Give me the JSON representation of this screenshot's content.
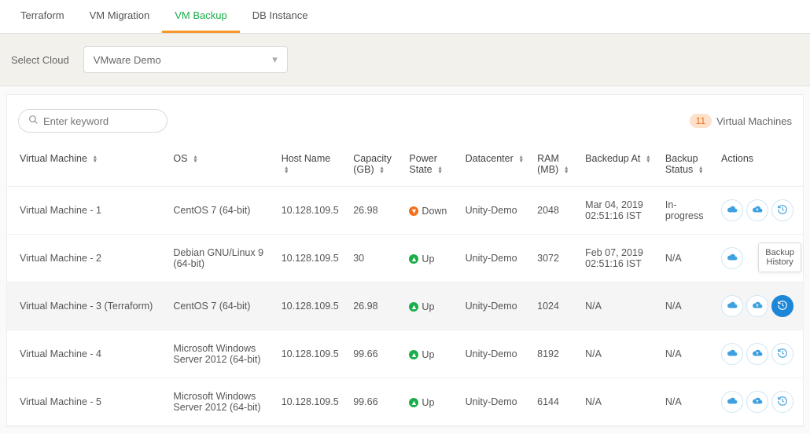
{
  "tabs": [
    "Terraform",
    "VM Migration",
    "VM Backup",
    "DB Instance"
  ],
  "activeTab": 2,
  "filter": {
    "label": "Select Cloud",
    "value": "VMware Demo"
  },
  "search": {
    "placeholder": "Enter keyword"
  },
  "count": {
    "value": "11",
    "label": "Virtual Machines"
  },
  "columns": [
    "Virtual Machine",
    "OS",
    "Host Name",
    "Capacity (GB)",
    "Power State",
    "Datacenter",
    "RAM (MB)",
    "Backedup At",
    "Backup Status",
    "Actions"
  ],
  "tooltip": "Backup History",
  "rows": [
    {
      "vm": "Virtual Machine - 1",
      "os": "CentOS 7 (64-bit)",
      "host": "10.128.109.5",
      "cap": "26.98",
      "power": "Down",
      "dc": "Unity-Demo",
      "ram": "2048",
      "backedup": "Mar 04, 2019 02:51:16 IST",
      "status": "In-progress",
      "hl": false,
      "tooltip": false,
      "press": false
    },
    {
      "vm": "Virtual Machine - 2",
      "os": "Debian GNU/Linux 9 (64-bit)",
      "host": "10.128.109.5",
      "cap": "30",
      "power": "Up",
      "dc": "Unity-Demo",
      "ram": "3072",
      "backedup": "Feb 07, 2019 02:51:16 IST",
      "status": "N/A",
      "hl": false,
      "tooltip": true,
      "press": false
    },
    {
      "vm": "Virtual Machine - 3 (Terraform)",
      "os": "CentOS 7 (64-bit)",
      "host": "10.128.109.5",
      "cap": "26.98",
      "power": "Up",
      "dc": "Unity-Demo",
      "ram": "1024",
      "backedup": "N/A",
      "status": "N/A",
      "hl": true,
      "tooltip": false,
      "press": true
    },
    {
      "vm": "Virtual Machine - 4",
      "os": "Microsoft Windows Server 2012 (64-bit)",
      "host": "10.128.109.5",
      "cap": "99.66",
      "power": "Up",
      "dc": "Unity-Demo",
      "ram": "8192",
      "backedup": "N/A",
      "status": "N/A",
      "hl": false,
      "tooltip": false,
      "press": false
    },
    {
      "vm": "Virtual Machine - 5",
      "os": "Microsoft Windows Server 2012 (64-bit)",
      "host": "10.128.109.5",
      "cap": "99.66",
      "power": "Up",
      "dc": "Unity-Demo",
      "ram": "6144",
      "backedup": "N/A",
      "status": "N/A",
      "hl": false,
      "tooltip": false,
      "press": false
    }
  ]
}
